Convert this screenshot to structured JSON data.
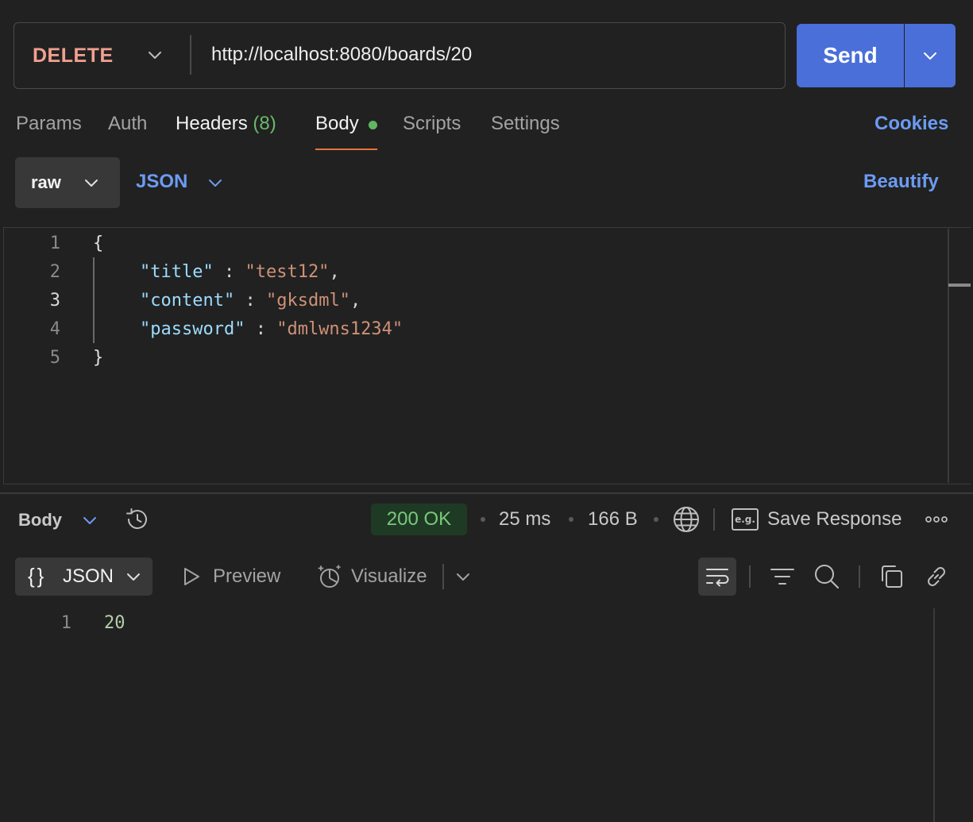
{
  "request": {
    "method": "DELETE",
    "url": "http://localhost:8080/boards/20",
    "send_label": "Send"
  },
  "tabs": {
    "params": "Params",
    "auth": "Auth",
    "headers": "Headers",
    "headers_count": "(8)",
    "body": "Body",
    "scripts": "Scripts",
    "settings": "Settings",
    "active": "Body"
  },
  "cookies_label": "Cookies",
  "body_mode": {
    "mode": "raw",
    "language": "JSON",
    "beautify_label": "Beautify"
  },
  "request_body": {
    "line_numbers": [
      "1",
      "2",
      "3",
      "4",
      "5"
    ],
    "open_brace": "{",
    "close_brace": "}",
    "fields": [
      {
        "key": "\"title\"",
        "value": "\"test12\"",
        "trail": ","
      },
      {
        "key": "\"content\"",
        "value": "\"gksdml\"",
        "trail": ","
      },
      {
        "key": "\"password\"",
        "value": "\"dmlwns1234\"",
        "trail": ""
      }
    ],
    "separator": " : "
  },
  "response": {
    "section_label": "Body",
    "status": "200 OK",
    "time": "25 ms",
    "size": "166 B",
    "save_label": "Save Response",
    "format_braces": "{}",
    "format_label": "JSON",
    "preview_label": "Preview",
    "visualize_label": "Visualize",
    "line_number": "1",
    "value": "20"
  },
  "colors": {
    "accent_blue": "#4a6fd9",
    "link_blue": "#6c9bf2",
    "method_delete": "#f1a08f",
    "status_ok": "#79c97a",
    "tab_indicator": "#e8733a"
  }
}
